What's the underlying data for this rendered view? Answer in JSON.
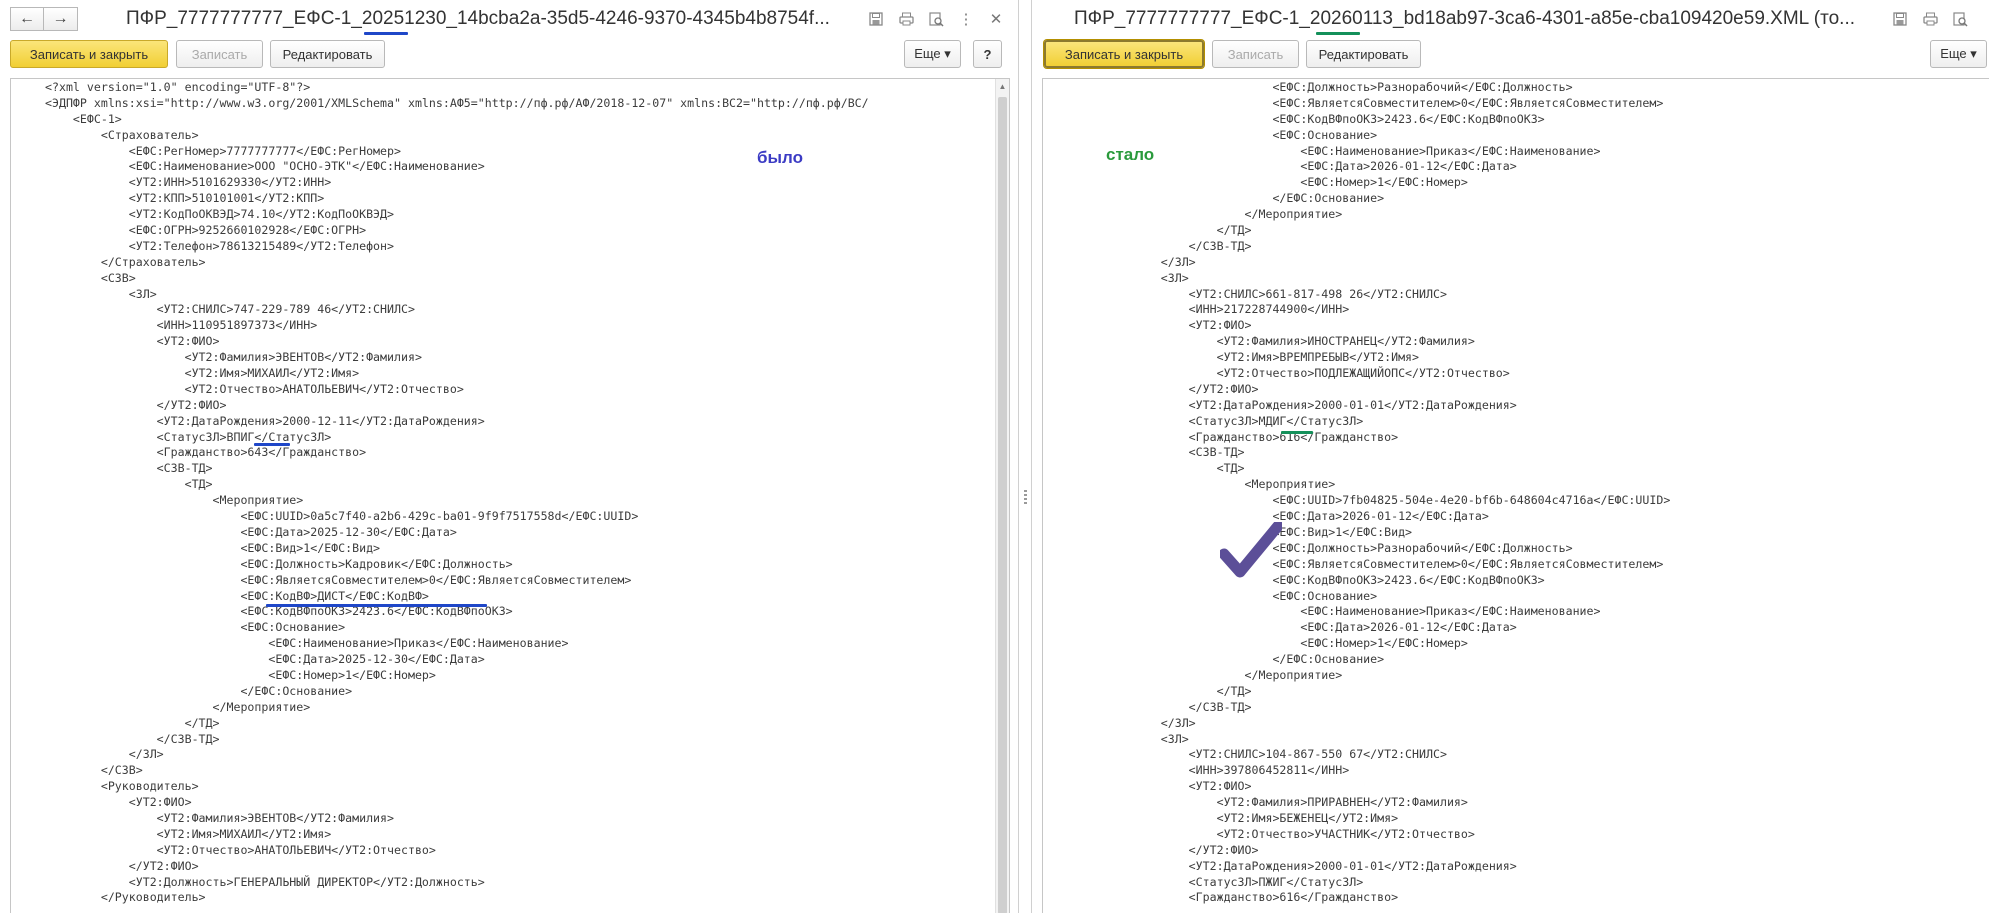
{
  "colors": {
    "accent_blue": "#1f47c8",
    "accent_green": "#14905a",
    "note_blue": "#3b3bc4",
    "note_green": "#2a9a3c",
    "checkmark": "#5c4f98",
    "primary_button": "#f1cf34"
  },
  "left": {
    "title": "ПФР_7777777777_ЕФС-1_20251230_14bcba2a-35d5-4246-9370-4345b4b8754f...",
    "toolbar": {
      "save_close": "Записать и закрыть",
      "save": "Записать",
      "edit": "Редактировать",
      "more": "Еще ▾",
      "help": "?"
    },
    "annotation": "было",
    "lines": [
      "<?xml version=\"1.0\" encoding=\"UTF-8\"?>",
      "<ЭДПФР xmlns:xsi=\"http://www.w3.org/2001/XMLSchema\" xmlns:АФ5=\"http://пф.рф/АФ/2018-12-07\" xmlns:ВС2=\"http://пф.рф/ВС/",
      "    <ЕФС-1>",
      "        <Страхователь>",
      "            <ЕФС:РегНомер>7777777777</ЕФС:РегНомер>",
      "            <ЕФС:Наименование>ООО \"ОСНО-ЭТК\"</ЕФС:Наименование>",
      "            <УТ2:ИНН>5101629330</УТ2:ИНН>",
      "            <УТ2:КПП>510101001</УТ2:КПП>",
      "            <УТ2:КодПоОКВЭД>74.10</УТ2:КодПоОКВЭД>",
      "            <ЕФС:ОГРН>9252660102928</ЕФС:ОГРН>",
      "            <УТ2:Телефон>78613215489</УТ2:Телефон>",
      "        </Страхователь>",
      "        <СЗВ>",
      "            <ЗЛ>",
      "                <УТ2:СНИЛС>747-229-789 46</УТ2:СНИЛС>",
      "                <ИНН>110951897373</ИНН>",
      "                <УТ2:ФИО>",
      "                    <УТ2:Фамилия>ЭВЕНТОВ</УТ2:Фамилия>",
      "                    <УТ2:Имя>МИХАИЛ</УТ2:Имя>",
      "                    <УТ2:Отчество>АНАТОЛЬЕВИЧ</УТ2:Отчество>",
      "                </УТ2:ФИО>",
      "                <УТ2:ДатаРождения>2000-12-11</УТ2:ДатаРождения>",
      "                <СтатусЗЛ>ВПИГ</СтатусЗЛ>",
      "                <Гражданство>643</Гражданство>",
      "                <СЗВ-ТД>",
      "                    <ТД>",
      "                        <Мероприятие>",
      "                            <ЕФС:UUID>0a5c7f40-a2b6-429c-ba01-9f9f7517558d</ЕФС:UUID>",
      "                            <ЕФС:Дата>2025-12-30</ЕФС:Дата>",
      "                            <ЕФС:Вид>1</ЕФС:Вид>",
      "                            <ЕФС:Должность>Кадровик</ЕФС:Должность>",
      "                            <ЕФС:ЯвляетсяСовместителем>0</ЕФС:ЯвляетсяСовместителем>",
      "                            <ЕФС:КодВФ>ДИСТ</ЕФС:КодВФ>",
      "                            <ЕФС:КодВФпоОКЗ>2423.6</ЕФС:КодВФпоОКЗ>",
      "                            <ЕФС:Основание>",
      "                                <ЕФС:Наименование>Приказ</ЕФС:Наименование>",
      "                                <ЕФС:Дата>2025-12-30</ЕФС:Дата>",
      "                                <ЕФС:Номер>1</ЕФС:Номер>",
      "                            </ЕФС:Основание>",
      "                        </Мероприятие>",
      "                    </ТД>",
      "                </СЗВ-ТД>",
      "            </ЗЛ>",
      "        </СЗВ>",
      "        <Руководитель>",
      "            <УТ2:ФИО>",
      "                <УТ2:Фамилия>ЭВЕНТОВ</УТ2:Фамилия>",
      "                <УТ2:Имя>МИХАИЛ</УТ2:Имя>",
      "                <УТ2:Отчество>АНАТОЛЬЕВИЧ</УТ2:Отчество>",
      "            </УТ2:ФИО>",
      "            <УТ2:Должность>ГЕНЕРАЛЬНЫЙ ДИРЕКТОР</УТ2:Должность>",
      "        </Руководитель>"
    ]
  },
  "right": {
    "title": "ПФР_7777777777_ЕФС-1_20260113_bd18ab97-3ca6-4301-a85e-cba109420e59.XML (то...",
    "toolbar": {
      "save_close": "Записать и закрыть",
      "save": "Записать",
      "edit": "Редактировать",
      "more": "Еще ▾"
    },
    "annotation": "стало",
    "lines": [
      "                            <ЕФС:Должность>Разнорабочий</ЕФС:Должность>",
      "                            <ЕФС:ЯвляетсяСовместителем>0</ЕФС:ЯвляетсяСовместителем>",
      "                            <ЕФС:КодВФпоОКЗ>2423.6</ЕФС:КодВФпоОКЗ>",
      "                            <ЕФС:Основание>",
      "                                <ЕФС:Наименование>Приказ</ЕФС:Наименование>",
      "                                <ЕФС:Дата>2026-01-12</ЕФС:Дата>",
      "                                <ЕФС:Номер>1</ЕФС:Номер>",
      "                            </ЕФС:Основание>",
      "                        </Мероприятие>",
      "                    </ТД>",
      "                </СЗВ-ТД>",
      "            </ЗЛ>",
      "            <ЗЛ>",
      "                <УТ2:СНИЛС>661-817-498 26</УТ2:СНИЛС>",
      "                <ИНН>217228744900</ИНН>",
      "                <УТ2:ФИО>",
      "                    <УТ2:Фамилия>ИНОСТРАНЕЦ</УТ2:Фамилия>",
      "                    <УТ2:Имя>ВРЕМПРЕБЫВ</УТ2:Имя>",
      "                    <УТ2:Отчество>ПОДЛЕЖАЩИЙОПС</УТ2:Отчество>",
      "                </УТ2:ФИО>",
      "                <УТ2:ДатаРождения>2000-01-01</УТ2:ДатаРождения>",
      "                <СтатусЗЛ>МДИГ</СтатусЗЛ>",
      "                <Гражданство>616</Гражданство>",
      "                <СЗВ-ТД>",
      "                    <ТД>",
      "                        <Мероприятие>",
      "                            <ЕФС:UUID>7fb04825-504e-4e20-bf6b-648604c4716a</ЕФС:UUID>",
      "                            <ЕФС:Дата>2026-01-12</ЕФС:Дата>",
      "                            <ЕФС:Вид>1</ЕФС:Вид>",
      "                            <ЕФС:Должность>Разнорабочий</ЕФС:Должность>",
      "                            <ЕФС:ЯвляетсяСовместителем>0</ЕФС:ЯвляетсяСовместителем>",
      "                            <ЕФС:КодВФпоОКЗ>2423.6</ЕФС:КодВФпоОКЗ>",
      "                            <ЕФС:Основание>",
      "                                <ЕФС:Наименование>Приказ</ЕФС:Наименование>",
      "                                <ЕФС:Дата>2026-01-12</ЕФС:Дата>",
      "                                <ЕФС:Номер>1</ЕФС:Номер>",
      "                            </ЕФС:Основание>",
      "                        </Мероприятие>",
      "                    </ТД>",
      "                </СЗВ-ТД>",
      "            </ЗЛ>",
      "            <ЗЛ>",
      "                <УТ2:СНИЛС>104-867-550 67</УТ2:СНИЛС>",
      "                <ИНН>397806452811</ИНН>",
      "                <УТ2:ФИО>",
      "                    <УТ2:Фамилия>ПРИРАВНЕН</УТ2:Фамилия>",
      "                    <УТ2:Имя>БЕЖЕНЕЦ</УТ2:Имя>",
      "                    <УТ2:Отчество>УЧАСТНИК</УТ2:Отчество>",
      "                </УТ2:ФИО>",
      "                <УТ2:ДатаРождения>2000-01-01</УТ2:ДатаРождения>",
      "                <СтатусЗЛ>ПЖИГ</СтатусЗЛ>",
      "                <Гражданство>616</Гражданство>"
    ]
  }
}
